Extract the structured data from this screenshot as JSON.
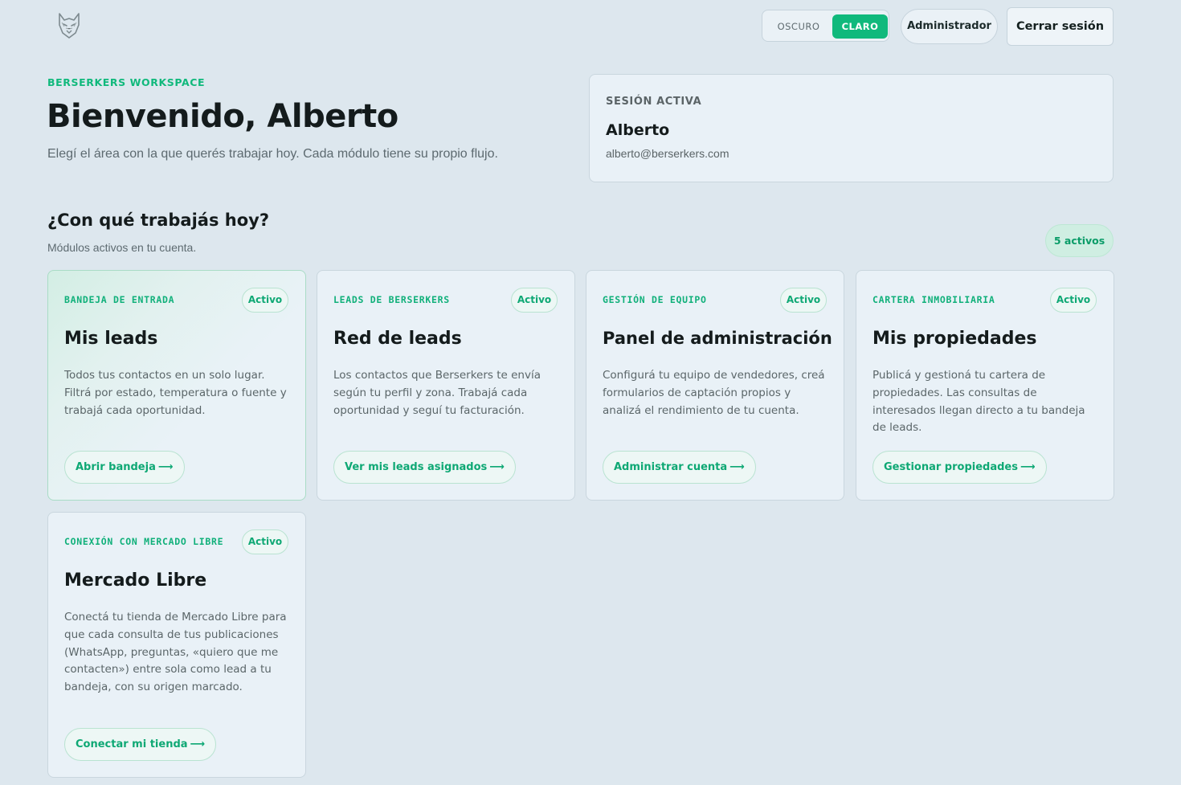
{
  "header": {
    "logo_icon": "wolf-logo-icon",
    "theme_toggle": {
      "dark_label": "OSCURO",
      "light_label": "CLARO",
      "selected": "light"
    },
    "role_label": "Administrador",
    "logout_label": "Cerrar sesión"
  },
  "hero": {
    "eyebrow": "BERSERKERS WORKSPACE",
    "title": "Bienvenido, Alberto",
    "subtitle": "Elegí el área con la que querés trabajar hoy. Cada módulo tiene su propio flujo."
  },
  "session": {
    "label": "SESIÓN ACTIVA",
    "name": "Alberto",
    "email": "alberto@berserkers.com"
  },
  "modules": {
    "title": "¿Con qué trabajás hoy?",
    "subtitle": "Módulos activos en tu cuenta.",
    "count_label": "5 activos",
    "cards": [
      {
        "category": "BANDEJA DE ENTRADA",
        "badge": "Activo",
        "title": "Mis leads",
        "description": "Todos tus contactos en un solo lugar. Filtrá por estado, temperatura o fuente y trabajá cada oportunidad.",
        "action": "Abrir bandeja"
      },
      {
        "category": "LEADS DE BERSERKERS",
        "badge": "Activo",
        "title": "Red de leads",
        "description": "Los contactos que Berserkers te envía según tu perfil y zona. Trabajá cada oportunidad y seguí tu facturación.",
        "action": "Ver mis leads asignados"
      },
      {
        "category": "GESTIÓN DE EQUIPO",
        "badge": "Activo",
        "title": "Panel de administración",
        "description": "Configurá tu equipo de vendedores, creá formularios de captación propios y analizá el rendimiento de tu cuenta.",
        "action": "Administrar cuenta"
      },
      {
        "category": "CARTERA INMOBILIARIA",
        "badge": "Activo",
        "title": "Mis propiedades",
        "description": "Publicá y gestioná tu cartera de propiedades. Las consultas de interesados llegan directo a tu bandeja de leads.",
        "action": "Gestionar propiedades"
      },
      {
        "category": "CONEXIÓN CON MERCADO LIBRE",
        "badge": "Activo",
        "title": "Mercado Libre",
        "description": "Conectá tu tienda de Mercado Libre para que cada consulta de tus publicaciones (WhatsApp, preguntas, «quiero que me contacten») entre sola como lead a tu bandeja, con su origen marcado.",
        "action": "Conectar mi tienda"
      }
    ]
  },
  "colors": {
    "accent": "#10b97c",
    "background": "#dde7ee",
    "card": "#e9f1f7"
  }
}
